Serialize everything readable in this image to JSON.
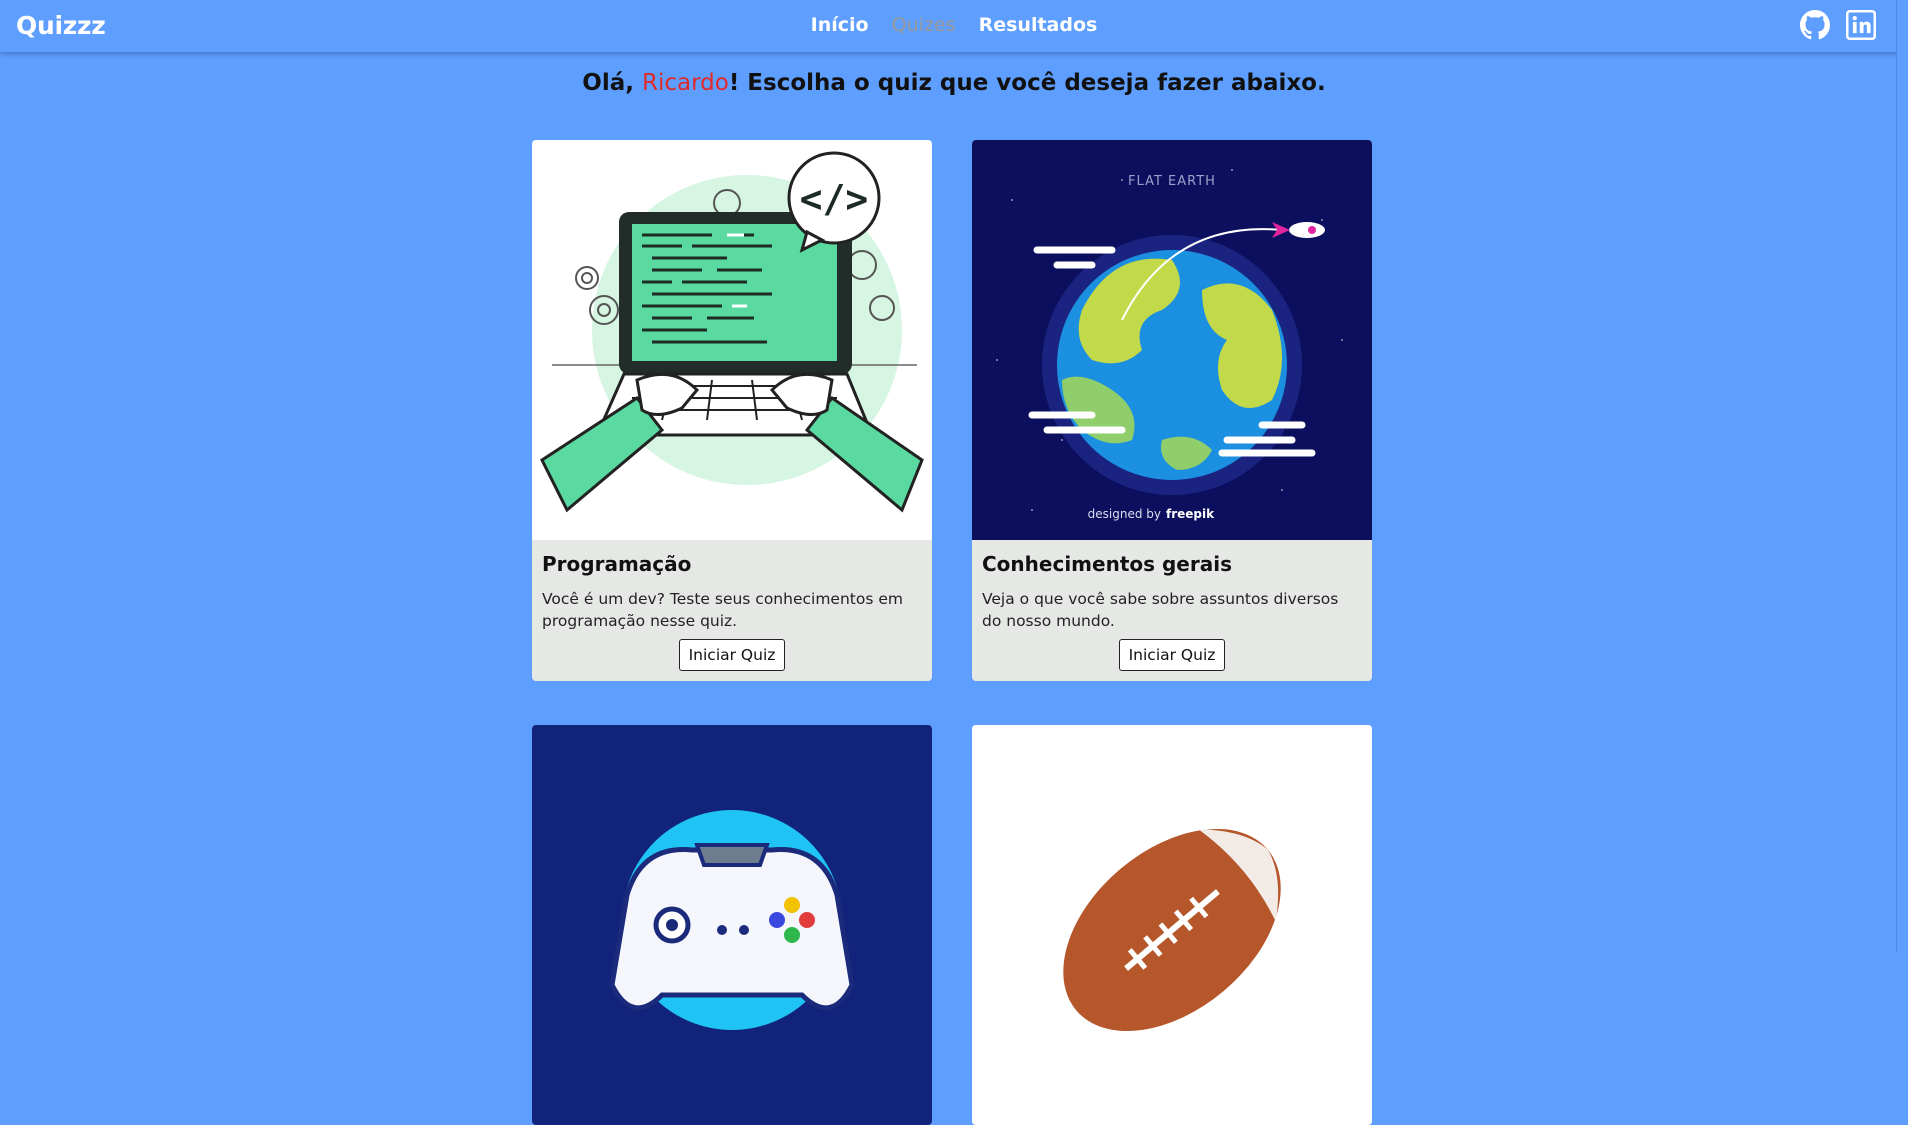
{
  "navbar": {
    "brand": "Quizzz",
    "links": [
      "Início",
      "Quizes",
      "Resultados"
    ],
    "social": [
      "github-icon",
      "linkedin-icon"
    ]
  },
  "greeting": {
    "prefix": "Olá, ",
    "name": "Ricardo",
    "suffix": "! Escolha o quiz que você deseja fazer abaixo."
  },
  "quizzes": [
    {
      "title": "Programação",
      "description": "Você é um dev? Teste seus conhecimentos em programação nesse quiz.",
      "button": "Iniciar Quiz",
      "image": "laptop-coding-illustration"
    },
    {
      "title": "Conhecimentos gerais",
      "description": "Veja o que você sabe sobre assuntos diversos do nosso mundo.",
      "button": "Iniciar Quiz",
      "image": "flat-earth-illustration",
      "image_text": [
        "FLAT EARTH",
        "designed by",
        "freepik"
      ]
    },
    {
      "image": "game-controller-illustration"
    },
    {
      "image": "american-football-illustration"
    }
  ],
  "colors": {
    "background": "#5e9eff",
    "card": "#e6e8e6",
    "highlight": "#e02a2a"
  }
}
